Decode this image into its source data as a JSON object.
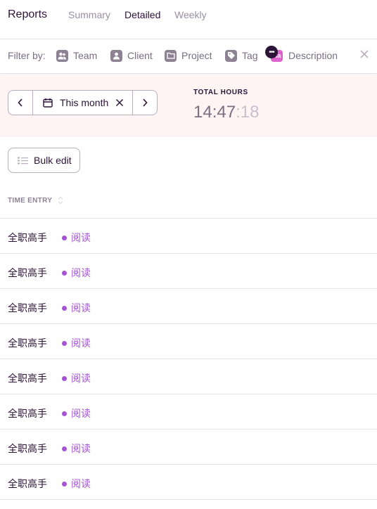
{
  "header": {
    "title": "Reports",
    "tabs": [
      {
        "label": "Summary",
        "active": false
      },
      {
        "label": "Detailed",
        "active": true
      },
      {
        "label": "Weekly",
        "active": false
      }
    ]
  },
  "filters": {
    "label": "Filter by:",
    "items": [
      {
        "label": "Team",
        "icon": "team-icon"
      },
      {
        "label": "Client",
        "icon": "client-icon"
      },
      {
        "label": "Project",
        "icon": "project-icon"
      },
      {
        "label": "Tag",
        "icon": "tag-icon"
      },
      {
        "label": "Description",
        "icon": "description-icon",
        "icon_text": "Aa"
      }
    ],
    "more_icon": "more-icon",
    "clear_icon": "close-icon"
  },
  "summary": {
    "date_range": "This month",
    "total_label": "TOTAL HOURS",
    "total_hm": "14:47",
    "total_sec": ":18"
  },
  "toolbar": {
    "bulk_edit_label": "Bulk edit"
  },
  "table": {
    "column_header": "TIME ENTRY",
    "rows": [
      {
        "description": "全职高手",
        "project": "阅读",
        "project_color": "#a653d3"
      },
      {
        "description": "全职高手",
        "project": "阅读",
        "project_color": "#a653d3"
      },
      {
        "description": "全职高手",
        "project": "阅读",
        "project_color": "#a653d3"
      },
      {
        "description": "全职高手",
        "project": "阅读",
        "project_color": "#a653d3"
      },
      {
        "description": "全职高手",
        "project": "阅读",
        "project_color": "#a653d3"
      },
      {
        "description": "全职高手",
        "project": "阅读",
        "project_color": "#a653d3"
      },
      {
        "description": "全职高手",
        "project": "阅读",
        "project_color": "#a653d3"
      },
      {
        "description": "全职高手",
        "project": "阅读",
        "project_color": "#a653d3"
      }
    ]
  },
  "colors": {
    "accent": "#2c1338",
    "muted": "#7a6e82",
    "summary_bg": "#fdf4f3",
    "project_purple": "#a653d3"
  }
}
